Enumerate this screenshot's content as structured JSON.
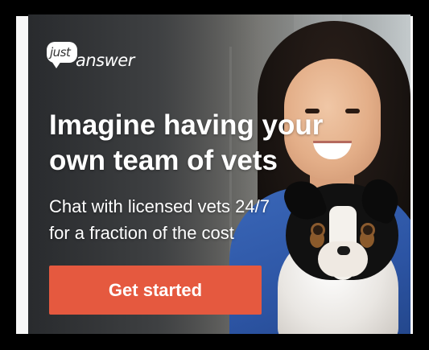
{
  "brand": {
    "logo_top": "just",
    "logo_main": "answer"
  },
  "ad": {
    "headline_line1": "Imagine having your",
    "headline_line2": "own team of vets",
    "subhead_line1": "Chat with licensed vets 24/7",
    "subhead_line2": "for a fraction of the cost",
    "cta_label": "Get started"
  },
  "colors": {
    "cta_background": "#e5593f",
    "text": "#ffffff",
    "frame_background": "#000000"
  }
}
